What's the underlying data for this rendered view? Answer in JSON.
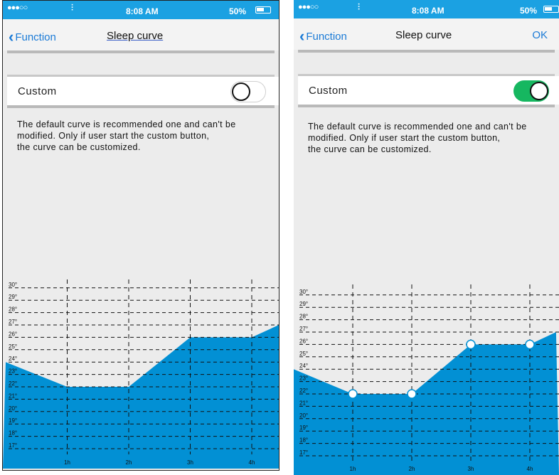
{
  "left": {
    "status": {
      "time": "8:08 AM",
      "battery": "50%"
    },
    "nav": {
      "back_label": "Function",
      "title": "Sleep curve"
    },
    "custom": {
      "label": "Custom",
      "enabled": false
    },
    "description": [
      "The default curve is recommended one and can't be",
      "modified. Only if user start the custom button,",
      "the curve can be customized."
    ],
    "chart_data": {
      "type": "area",
      "title": "",
      "xlabel": "",
      "ylabel": "",
      "x_ticks": [
        "1h",
        "2h",
        "3h",
        "4h"
      ],
      "y_ticks": [
        "17°",
        "18°",
        "19°",
        "20°",
        "21°",
        "22°",
        "23°",
        "24°",
        "25°",
        "26°",
        "27°",
        "28°",
        "29°",
        "30°"
      ],
      "ylim": [
        16,
        30
      ],
      "x": [
        0,
        1,
        2,
        3,
        4,
        4.5
      ],
      "values": [
        24,
        22,
        22,
        26,
        26,
        27
      ],
      "fill_color": "#0290d4",
      "show_points": false
    }
  },
  "right": {
    "status": {
      "time": "8:08 AM",
      "battery": "50%"
    },
    "nav": {
      "back_label": "Function",
      "title": "Sleep curve",
      "ok_label": "OK"
    },
    "custom": {
      "label": "Custom",
      "enabled": true
    },
    "description": [
      "The default curve is recommended one and can't be",
      "modified. Only if user start the custom button,",
      "the curve can be customized."
    ],
    "chart_data": {
      "type": "area",
      "title": "",
      "xlabel": "",
      "ylabel": "",
      "x_ticks": [
        "1h",
        "2h",
        "3h",
        "4h"
      ],
      "y_ticks": [
        "17°",
        "18°",
        "19°",
        "20°",
        "21°",
        "22°",
        "23°",
        "24°",
        "25°",
        "26°",
        "27°",
        "28°",
        "29°",
        "30°"
      ],
      "ylim": [
        16,
        30
      ],
      "x": [
        0,
        1,
        2,
        3,
        4,
        4.45
      ],
      "values": [
        24,
        22,
        22,
        26,
        26,
        27
      ],
      "fill_color": "#0290d4",
      "show_points": true,
      "point_x": [
        1,
        2,
        3,
        4
      ]
    }
  },
  "colors": {
    "accent": "#1a7ad6",
    "status_bar": "#1ba1e2",
    "toggle_on": "#16b760",
    "chart_fill": "#0290d4"
  }
}
